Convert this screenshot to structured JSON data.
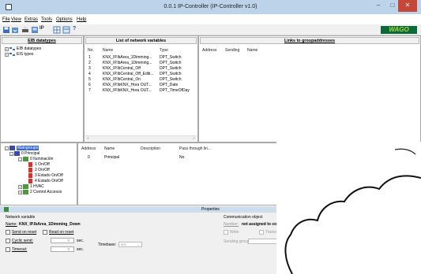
{
  "window": {
    "title": "0.0.1 IP-Controller (IP-Controller v1.0)",
    "controls": {
      "minimize": "–",
      "maximize": "□",
      "close": "✕"
    }
  },
  "menu": [
    "File",
    "View",
    "Extras",
    "Tools",
    "Options",
    "Help"
  ],
  "toolbar": {
    "ip_label": "IP",
    "help_label": "?"
  },
  "brand": {
    "logo_text": "WAGO",
    "logo_bg": "#0b6a3a",
    "logo_fg": "#a8d63e"
  },
  "eib_panel": {
    "header": "EIB datatypes",
    "items": [
      "EIB datatypes",
      "EIS types"
    ]
  },
  "network_vars": {
    "header": "List of network variables",
    "columns": [
      "No.",
      "Name",
      "Type"
    ],
    "rows": [
      [
        "1",
        "KNX_IP.lbArea_1Dimming...",
        "DPT_Switch"
      ],
      [
        "2",
        "KNX_IP.lbArea_1Dimming...",
        "DPT_Switch"
      ],
      [
        "3",
        "KNX_IP.lbCentral_Off",
        "DPT_Switch"
      ],
      [
        "4",
        "KNX_IP.lbCentral_Off_Editi...",
        "DPT_Switch"
      ],
      [
        "5",
        "KNX_IP.lbCentral_On",
        "DPT_Switch"
      ],
      [
        "6",
        "KNX_IP.lbKNX_Hora OUT...",
        "DPT_Date"
      ],
      [
        "7",
        "KNX_IP.lbKNX_Hora OUT...",
        "DPT_TimeOfDay"
      ]
    ]
  },
  "links_panel": {
    "header": "Links to groupaddresses",
    "columns": [
      "Address",
      "Sending",
      "Name"
    ]
  },
  "main_tree": {
    "root": "Maingroups",
    "items": [
      {
        "label": "0 Principal",
        "level": 1
      },
      {
        "label": "0 Iluminación",
        "level": 2
      },
      {
        "label": "1 On/Off",
        "level": 3
      },
      {
        "label": "2 On/Off",
        "level": 3
      },
      {
        "label": "3 Estado On/Off",
        "level": 3
      },
      {
        "label": "4 Estado On/Off",
        "level": 3
      },
      {
        "label": "1 HVAC",
        "level": 2
      },
      {
        "label": "2 Control Accesos",
        "level": 2
      }
    ]
  },
  "group_table": {
    "columns": [
      "Address",
      "Name",
      "Description",
      "Pass through lin..."
    ],
    "rows": [
      [
        "0",
        "Principal",
        "",
        "No"
      ]
    ]
  },
  "properties": {
    "title": "Properties",
    "network_variable_label": "Network variable",
    "name_label": "Name:",
    "name_value": "KNX_IP.lbArea_1Dimming_Down",
    "send_on_reset": "Send on reset",
    "read_on_reset": "Read on reset",
    "cyclic_send": "Cyclic send:",
    "cyclic_value": "0",
    "timeout": "Timeout:",
    "timeout_value": "0",
    "sec_unit": "sec.",
    "timebase_label": "Timebase:",
    "timebase_value": "sec",
    "comm_object_label": "Communication object",
    "number_label": "Number:",
    "number_value": "not assigned to commu",
    "write_label": "Write",
    "transmit_label": "Transmissi",
    "sending_group_label": "Sending group:"
  }
}
